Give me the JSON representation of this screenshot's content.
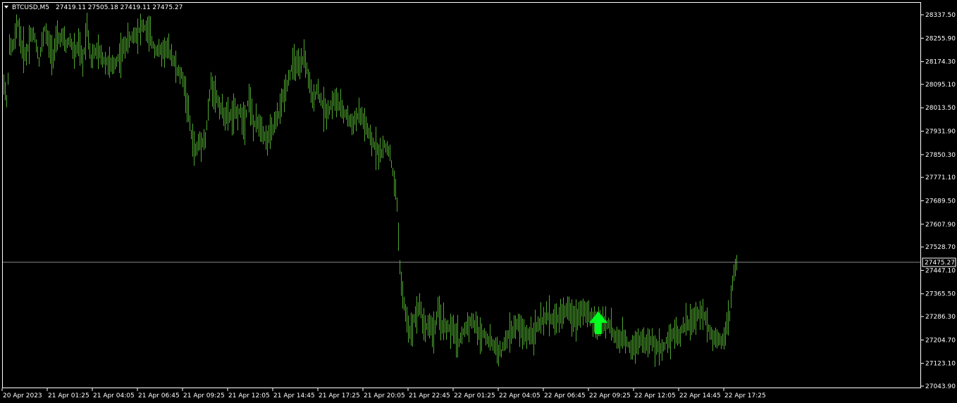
{
  "header": {
    "symbol": "BTCUSD,M5",
    "ohlc": "27419.11 27505.18 27419.11 27475.27"
  },
  "colors": {
    "background": "#000000",
    "frame": "#ffffff",
    "bar": "#4fa82f",
    "price_line": "#8a8a8a",
    "arrow": "#00ff1e",
    "text": "#ffffff"
  },
  "chart_data": {
    "type": "ohlc",
    "grid": false,
    "ylim": [
      27043.9,
      28378.2
    ],
    "y_ticks": [
      "28337.50",
      "28255.90",
      "28174.30",
      "28095.10",
      "28013.50",
      "27931.90",
      "27850.30",
      "27771.10",
      "27689.50",
      "27607.90",
      "27528.70",
      "27447.10",
      "27365.50",
      "27286.30",
      "27204.70",
      "27123.10",
      "27043.90"
    ],
    "x_ticks": [
      "20 Apr 2023",
      "21 Apr 01:25",
      "21 Apr 04:05",
      "21 Apr 06:45",
      "21 Apr 09:25",
      "21 Apr 12:05",
      "21 Apr 14:45",
      "21 Apr 17:25",
      "21 Apr 20:05",
      "21 Apr 22:45",
      "22 Apr 01:25",
      "22 Apr 04:05",
      "22 Apr 06:45",
      "22 Apr 09:25",
      "22 Apr 12:05",
      "22 Apr 14:45",
      "22 Apr 17:25"
    ],
    "current_price": "27475.27",
    "signal": {
      "type": "buy-arrow",
      "time": "22 Apr 09:25",
      "price": 27278
    },
    "price_path": [
      [
        0,
        28150
      ],
      [
        6,
        28030
      ],
      [
        10,
        28220
      ],
      [
        16,
        28230
      ],
      [
        22,
        28310
      ],
      [
        28,
        28220
      ],
      [
        34,
        28200
      ],
      [
        40,
        28270
      ],
      [
        46,
        28260
      ],
      [
        52,
        28180
      ],
      [
        60,
        28290
      ],
      [
        66,
        28230
      ],
      [
        72,
        28200
      ],
      [
        78,
        28250
      ],
      [
        84,
        28260
      ],
      [
        90,
        28230
      ],
      [
        96,
        28250
      ],
      [
        102,
        28200
      ],
      [
        108,
        28230
      ],
      [
        114,
        28170
      ],
      [
        120,
        28300
      ],
      [
        126,
        28180
      ],
      [
        132,
        28210
      ],
      [
        138,
        28200
      ],
      [
        144,
        28180
      ],
      [
        150,
        28170
      ],
      [
        156,
        28150
      ],
      [
        162,
        28180
      ],
      [
        168,
        28200
      ],
      [
        176,
        28240
      ],
      [
        184,
        28260
      ],
      [
        192,
        28280
      ],
      [
        200,
        28300
      ],
      [
        208,
        28270
      ],
      [
        216,
        28220
      ],
      [
        224,
        28210
      ],
      [
        232,
        28220
      ],
      [
        240,
        28200
      ],
      [
        248,
        28140
      ],
      [
        256,
        28120
      ],
      [
        262,
        28030
      ],
      [
        268,
        27920
      ],
      [
        274,
        27860
      ],
      [
        280,
        27900
      ],
      [
        288,
        27900
      ],
      [
        296,
        28100
      ],
      [
        304,
        28050
      ],
      [
        312,
        28000
      ],
      [
        320,
        27980
      ],
      [
        328,
        27990
      ],
      [
        336,
        28000
      ],
      [
        344,
        27970
      ],
      [
        350,
        28060
      ],
      [
        356,
        27950
      ],
      [
        362,
        27960
      ],
      [
        368,
        27950
      ],
      [
        374,
        27900
      ],
      [
        380,
        27920
      ],
      [
        386,
        27950
      ],
      [
        392,
        27990
      ],
      [
        398,
        28050
      ],
      [
        404,
        28100
      ],
      [
        410,
        28150
      ],
      [
        416,
        28170
      ],
      [
        422,
        28140
      ],
      [
        428,
        28200
      ],
      [
        434,
        28120
      ],
      [
        440,
        28030
      ],
      [
        446,
        28080
      ],
      [
        452,
        28040
      ],
      [
        458,
        28000
      ],
      [
        464,
        28010
      ],
      [
        470,
        28040
      ],
      [
        476,
        28030
      ],
      [
        482,
        28000
      ],
      [
        488,
        27990
      ],
      [
        494,
        27960
      ],
      [
        500,
        27970
      ],
      [
        506,
        27990
      ],
      [
        512,
        27970
      ],
      [
        518,
        27930
      ],
      [
        524,
        27890
      ],
      [
        530,
        27880
      ],
      [
        536,
        27850
      ],
      [
        542,
        27880
      ],
      [
        548,
        27870
      ],
      [
        554,
        27790
      ],
      [
        560,
        27680
      ],
      [
        564,
        27460
      ],
      [
        568,
        27350
      ],
      [
        572,
        27300
      ],
      [
        576,
        27250
      ],
      [
        580,
        27230
      ],
      [
        584,
        27280
      ],
      [
        588,
        27300
      ],
      [
        592,
        27330
      ],
      [
        596,
        27270
      ],
      [
        600,
        27250
      ],
      [
        606,
        27260
      ],
      [
        612,
        27230
      ],
      [
        618,
        27300
      ],
      [
        624,
        27260
      ],
      [
        630,
        27250
      ],
      [
        636,
        27240
      ],
      [
        642,
        27230
      ],
      [
        648,
        27200
      ],
      [
        654,
        27230
      ],
      [
        660,
        27260
      ],
      [
        666,
        27270
      ],
      [
        672,
        27250
      ],
      [
        678,
        27220
      ],
      [
        684,
        27230
      ],
      [
        690,
        27200
      ],
      [
        696,
        27190
      ],
      [
        702,
        27170
      ],
      [
        708,
        27160
      ],
      [
        714,
        27200
      ],
      [
        720,
        27230
      ],
      [
        726,
        27240
      ],
      [
        732,
        27260
      ],
      [
        738,
        27230
      ],
      [
        744,
        27220
      ],
      [
        750,
        27230
      ],
      [
        756,
        27240
      ],
      [
        762,
        27260
      ],
      [
        768,
        27270
      ],
      [
        774,
        27290
      ],
      [
        780,
        27280
      ],
      [
        786,
        27270
      ],
      [
        792,
        27290
      ],
      [
        798,
        27310
      ],
      [
        804,
        27300
      ],
      [
        810,
        27290
      ],
      [
        816,
        27280
      ],
      [
        822,
        27320
      ],
      [
        828,
        27300
      ],
      [
        834,
        27280
      ],
      [
        840,
        27270
      ],
      [
        846,
        27260
      ],
      [
        852,
        27280
      ],
      [
        858,
        27260
      ],
      [
        864,
        27250
      ],
      [
        870,
        27210
      ],
      [
        876,
        27200
      ],
      [
        882,
        27210
      ],
      [
        888,
        27190
      ],
      [
        894,
        27180
      ],
      [
        900,
        27200
      ],
      [
        906,
        27210
      ],
      [
        912,
        27190
      ],
      [
        918,
        27200
      ],
      [
        924,
        27190
      ],
      [
        930,
        27180
      ],
      [
        936,
        27170
      ],
      [
        942,
        27200
      ],
      [
        948,
        27220
      ],
      [
        954,
        27230
      ],
      [
        960,
        27220
      ],
      [
        966,
        27250
      ],
      [
        972,
        27260
      ],
      [
        978,
        27270
      ],
      [
        984,
        27280
      ],
      [
        990,
        27300
      ],
      [
        996,
        27290
      ],
      [
        1002,
        27250
      ],
      [
        1008,
        27210
      ],
      [
        1014,
        27220
      ],
      [
        1020,
        27200
      ],
      [
        1026,
        27240
      ],
      [
        1032,
        27290
      ],
      [
        1036,
        27400
      ],
      [
        1040,
        27460
      ],
      [
        1042,
        27475.27
      ]
    ]
  }
}
